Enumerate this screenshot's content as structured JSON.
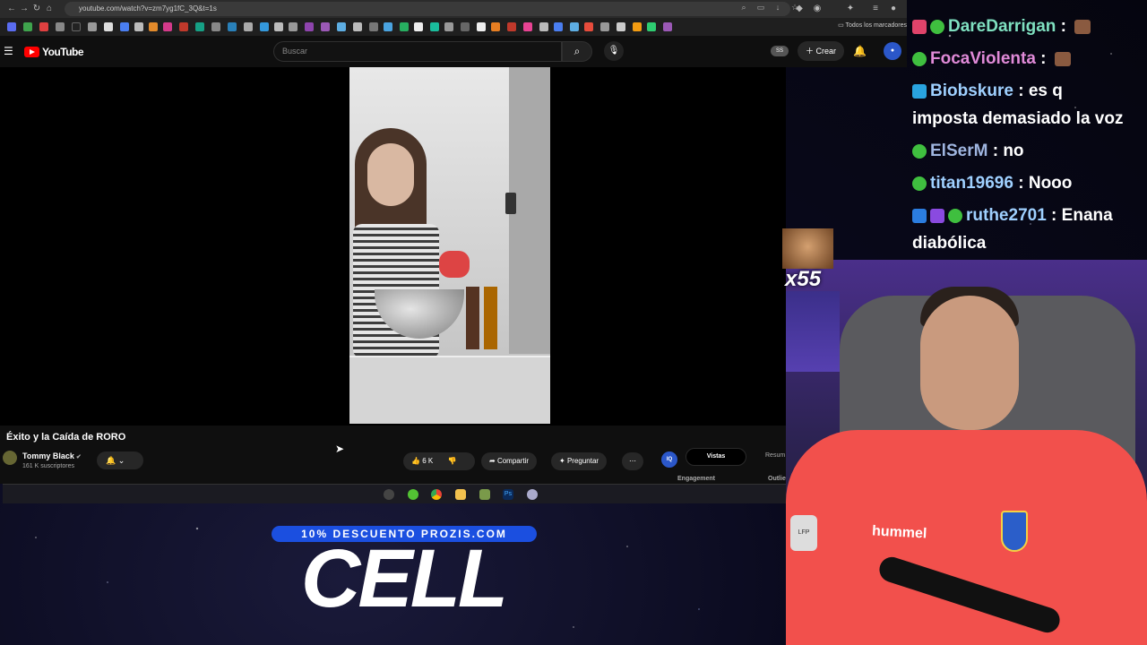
{
  "browser": {
    "url": "youtube.com/watch?v=zm7yg1fC_3Q&t=1s",
    "bookmarks_folder": "Todos los marcadores"
  },
  "youtube": {
    "logo_text": "YouTube",
    "search_placeholder": "Buscar",
    "ss_badge": "SS",
    "create_label": "Crear"
  },
  "video": {
    "title": "Éxito y la Caída de RORO",
    "channel": "Tommy Black",
    "subscribers": "161 K suscriptores",
    "likes": "6 K",
    "share_label": "Compartir",
    "ask_label": "Preguntar"
  },
  "side_panel": {
    "iq": "IQ",
    "tab_active": "Vistas",
    "tab_other": "Resum",
    "label_engagement": "Engagement",
    "label_outliers": "Outlie"
  },
  "promo": {
    "banner": "10% DESCUENTO PROZIS.COM",
    "big": "CELL"
  },
  "chat": [
    {
      "user": "DareDarrigan",
      "msg": "",
      "color": "#7fe0c0"
    },
    {
      "user": "FocaViolenta",
      "msg": "",
      "color": "#e08ad8"
    },
    {
      "user": "Biobskure",
      "msg": "es q",
      "color": "#9fd0ff"
    },
    {
      "msg_cont": "imposta demasiado la voz"
    },
    {
      "user": "ElSerM",
      "msg": "no",
      "color": "#9fb5e0"
    },
    {
      "user": "titan19696",
      "msg": "Nooo",
      "color": "#9fd0ff"
    },
    {
      "user": "ruthe2701",
      "msg": "Enana",
      "color": "#9fd0ff"
    },
    {
      "msg_cont": "diabólica"
    }
  ],
  "alert": {
    "multiplier": "x55"
  },
  "webcam": {
    "shirt_text": "hummel",
    "patch_text": "LFP"
  },
  "colors": {
    "yt_red": "#ff0000",
    "promo_blue": "#1b4fe0",
    "shirt": "#f2504c"
  }
}
